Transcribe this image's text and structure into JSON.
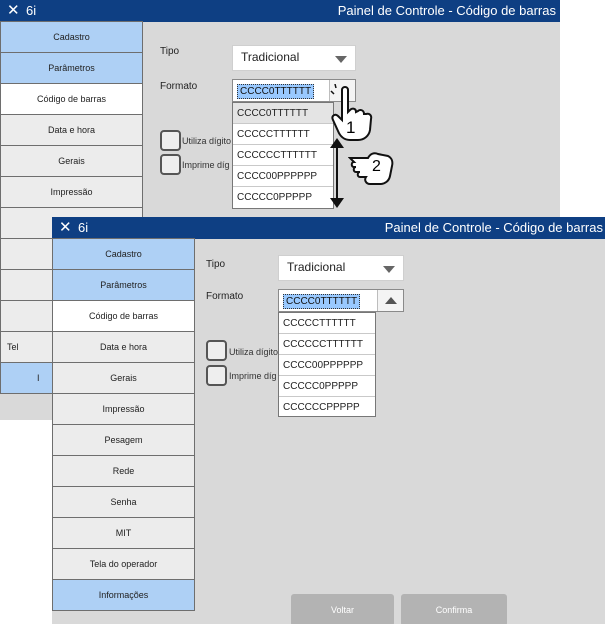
{
  "window": {
    "close_glyph": "✕",
    "app_name": "6i",
    "title": "Painel de Controle - Código de barras"
  },
  "sidebar_back": [
    "Cadastro",
    "Parâmetros",
    "Código de barras",
    "Data e hora",
    "Gerais",
    "Impressão"
  ],
  "sidebar_back_hidden_fragments": [
    "Tel",
    "I"
  ],
  "sidebar_front": [
    "Cadastro",
    "Parâmetros",
    "Código de barras",
    "Data e hora",
    "Gerais",
    "Impressão",
    "Pesagem",
    "Rede",
    "Senha",
    "MIT",
    "Tela do operador",
    "Informações"
  ],
  "form": {
    "tipo_label": "Tipo",
    "tipo_value": "Tradicional",
    "formato_label": "Formato",
    "formato_value": "CCCC0TTTTTT",
    "options_back": [
      "CCCC0TTTTTT",
      "CCCCCTTTTTT",
      "CCCCCCTTTTTT",
      "CCCC00PPPPPP",
      "CCCCC0PPPPP"
    ],
    "options_front": [
      "CCCCCTTTTTT",
      "CCCCCCTTTTTT",
      "CCCC00PPPPPP",
      "CCCCC0PPPPP",
      "CCCCCCPPPPP"
    ],
    "check1_label": "Utiliza dígito",
    "check2_label": "Imprime díg"
  },
  "buttons": {
    "back": "Voltar",
    "confirm": "Confirma"
  },
  "annotations": {
    "step1": "1",
    "step2": "2"
  },
  "colors": {
    "titlebar": "#0e3f83",
    "sidebar_blue": "#aed0f5",
    "panel_bg": "#d9d9d9",
    "selection": "#99c9ff"
  },
  "icons": {
    "close": "close-icon",
    "dropdown": "chevron-down-icon",
    "dropdown_open": "chevron-up-icon",
    "hand": "pointing-hand-icon",
    "scroll": "scroll-gesture-icon"
  }
}
